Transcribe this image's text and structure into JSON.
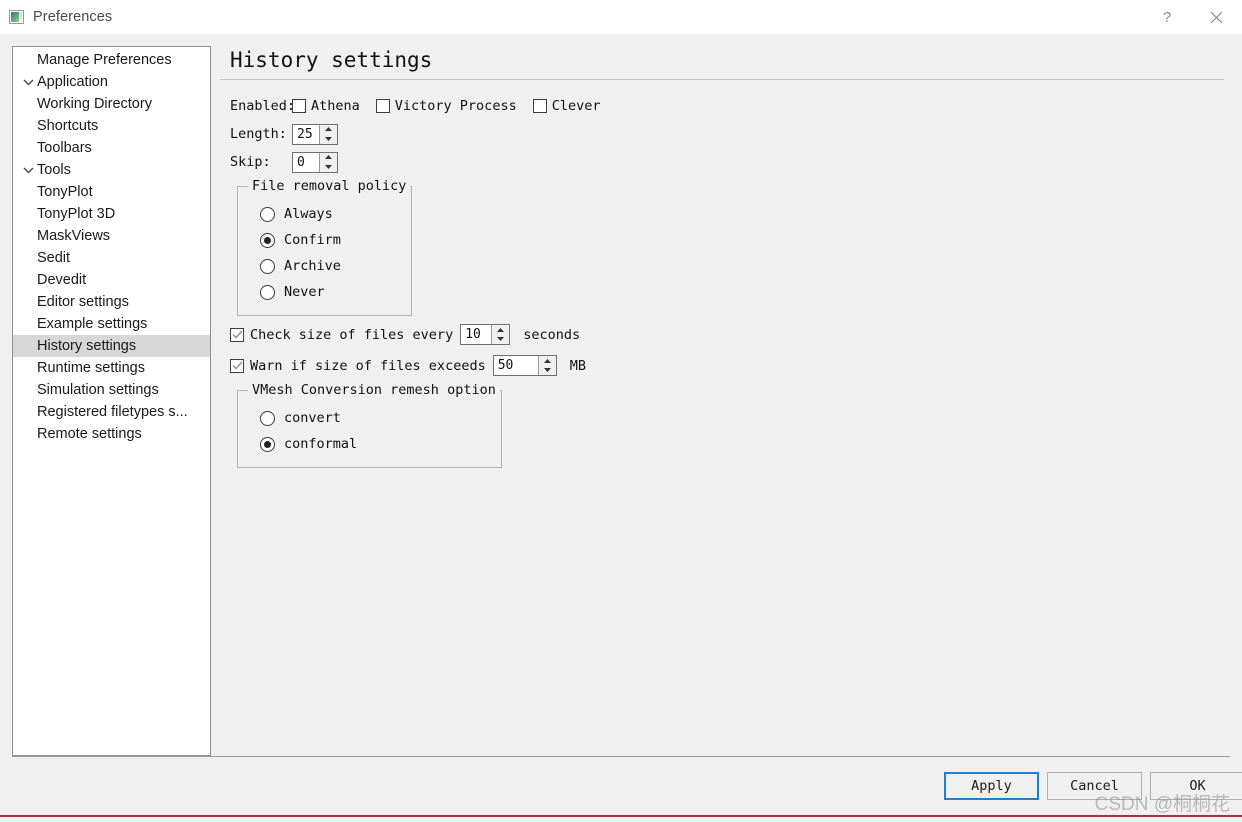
{
  "window": {
    "title": "Preferences",
    "icon": "image-preview-icon",
    "help_button": "?",
    "close_button": "×"
  },
  "sidebar": {
    "items": [
      {
        "label": "Manage Preferences",
        "level": 0,
        "arrow": "none",
        "selected": false
      },
      {
        "label": "Application",
        "level": 0,
        "arrow": "down",
        "selected": false
      },
      {
        "label": "Working Directory",
        "level": 1,
        "arrow": "none",
        "selected": false
      },
      {
        "label": "Shortcuts",
        "level": 1,
        "arrow": "none",
        "selected": false
      },
      {
        "label": "Toolbars",
        "level": 1,
        "arrow": "none",
        "selected": false
      },
      {
        "label": "Tools",
        "level": 0,
        "arrow": "down",
        "selected": false
      },
      {
        "label": "TonyPlot",
        "level": 1,
        "arrow": "none",
        "selected": false
      },
      {
        "label": "TonyPlot 3D",
        "level": 1,
        "arrow": "none",
        "selected": false
      },
      {
        "label": "MaskViews",
        "level": 1,
        "arrow": "none",
        "selected": false
      },
      {
        "label": "Sedit",
        "level": 1,
        "arrow": "none",
        "selected": false
      },
      {
        "label": "Devedit",
        "level": 1,
        "arrow": "none",
        "selected": false
      },
      {
        "label": "Editor settings",
        "level": 0,
        "arrow": "none",
        "selected": false
      },
      {
        "label": "Example settings",
        "level": 0,
        "arrow": "none",
        "selected": false
      },
      {
        "label": "History settings",
        "level": 0,
        "arrow": "none",
        "selected": true
      },
      {
        "label": "Runtime settings",
        "level": 0,
        "arrow": "none",
        "selected": false
      },
      {
        "label": "Simulation settings",
        "level": 0,
        "arrow": "none",
        "selected": false
      },
      {
        "label": "Registered filetypes s...",
        "level": 0,
        "arrow": "none",
        "selected": false
      },
      {
        "label": "Remote settings",
        "level": 0,
        "arrow": "none",
        "selected": false
      }
    ],
    "selected_highlight_color": "#d7d7d7"
  },
  "main": {
    "title": "History settings",
    "enabled": {
      "label": "Enabled:",
      "options": [
        {
          "label": "Athena",
          "checked": false
        },
        {
          "label": "Victory Process",
          "checked": false
        },
        {
          "label": "Clever",
          "checked": false
        }
      ]
    },
    "length": {
      "label": "Length:",
      "value": "25"
    },
    "skip": {
      "label": "Skip:",
      "value": "0"
    },
    "file_removal_policy": {
      "title": "File removal policy",
      "options": [
        {
          "label": "Always",
          "selected": false
        },
        {
          "label": "Confirm",
          "selected": true
        },
        {
          "label": "Archive",
          "selected": false
        },
        {
          "label": "Never",
          "selected": false
        }
      ]
    },
    "check_size": {
      "checked": true,
      "text_before": "Check size of files every",
      "value": "10",
      "text_after": "seconds"
    },
    "warn_size": {
      "checked": true,
      "text_before": "Warn if size of files exceeds",
      "value": "50",
      "text_after": "MB"
    },
    "vmesh": {
      "title": "VMesh Conversion remesh option",
      "options": [
        {
          "label": "convert",
          "selected": false
        },
        {
          "label": "conformal",
          "selected": true
        }
      ]
    }
  },
  "footer": {
    "apply_label": "Apply",
    "cancel_label": "Cancel",
    "ok_label": "OK",
    "focus_color": "#1d7fd4"
  },
  "watermark": {
    "text": "CSDN @桐桐花"
  }
}
